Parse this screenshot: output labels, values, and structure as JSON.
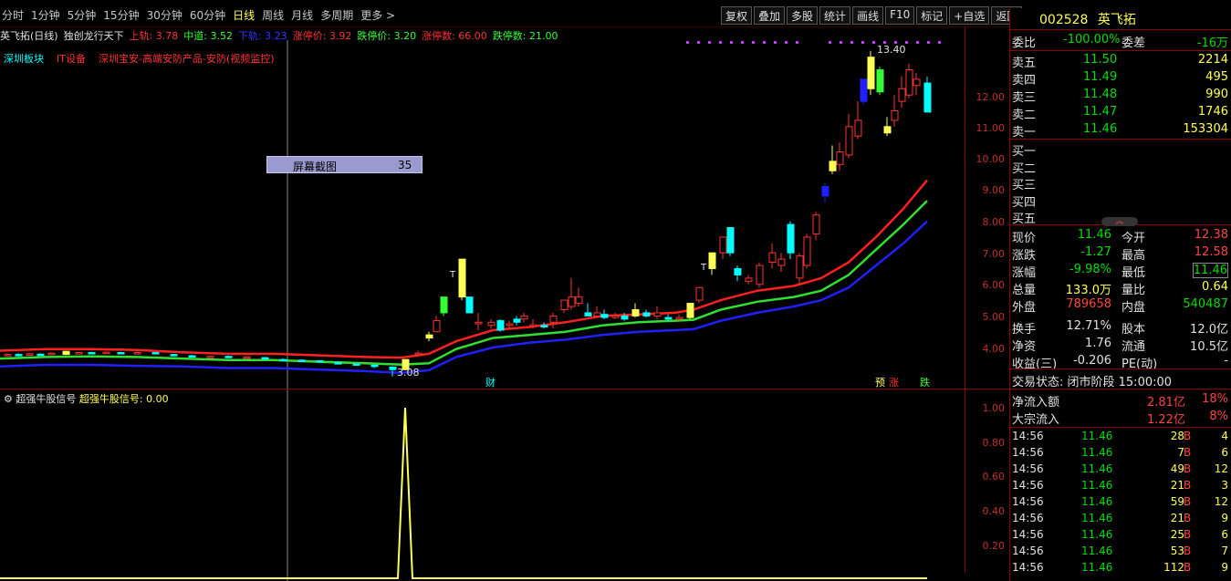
{
  "periods": [
    "分时",
    "1分钟",
    "5分钟",
    "15分钟",
    "30分钟",
    "60分钟",
    "日线",
    "周线",
    "月线",
    "多周期",
    "更多 >"
  ],
  "active_period": "日线",
  "tools": [
    "复权",
    "叠加",
    "多股",
    "统计",
    "画线",
    "F10",
    "标记",
    "+自选",
    "返回"
  ],
  "main_header": {
    "name": "英飞拓(日线)",
    "indicator": "独创龙行天下",
    "upper_label": "上轨: 3.78",
    "middle_label": "中道: 3.52",
    "lower_label": "下轨: 3.23",
    "limit_up_price": "涨停价: 3.92",
    "limit_down_price": "跌停价: 3.20",
    "limit_up_count": "涨停数: 66.00",
    "limit_down_count": "跌停数: 21.00"
  },
  "tags": {
    "board": "深圳板块",
    "industry": "IT设备",
    "concept": "深圳宝安-高端安防产品-安防(视频监控)"
  },
  "price_axis": [
    "12.00",
    "11.00",
    "10.00",
    "9.00",
    "8.00",
    "7.00",
    "6.00",
    "5.00",
    "4.00"
  ],
  "ind_axis": [
    "1.00",
    "0.80",
    "0.60",
    "0.40",
    "0.20"
  ],
  "annotations": {
    "high": "13.40",
    "low": "3.08",
    "cai": "财",
    "yu": "预",
    "zhang": "涨",
    "die": "跌",
    "t": "T"
  },
  "indicator_title": {
    "name": "超强牛股信号",
    "value": "超强牛股信号: 0.00"
  },
  "popup": {
    "label": "屏幕截图",
    "value": "35"
  },
  "quote": {
    "code": "002528",
    "name": "英飞拓",
    "weibi": {
      "label": "委比",
      "value": "-100.00%"
    },
    "weicha": {
      "label": "委差",
      "value": "-16万"
    },
    "asks": [
      {
        "label": "卖五",
        "price": "11.50",
        "vol": "2214"
      },
      {
        "label": "卖四",
        "price": "11.49",
        "vol": "495"
      },
      {
        "label": "卖三",
        "price": "11.48",
        "vol": "990"
      },
      {
        "label": "卖二",
        "price": "11.47",
        "vol": "1746"
      },
      {
        "label": "卖一",
        "price": "11.46",
        "vol": "153304"
      }
    ],
    "bids": [
      "买一",
      "买二",
      "买三",
      "买四",
      "买五"
    ],
    "stats": [
      {
        "l1": "现价",
        "v1": "11.46",
        "l2": "今开",
        "v2": "12.38"
      },
      {
        "l1": "涨跌",
        "v1": "-1.27",
        "l2": "最高",
        "v2": "12.58"
      },
      {
        "l1": "涨幅",
        "v1": "-9.98%",
        "l2": "最低",
        "v2": "11.46"
      },
      {
        "l1": "总量",
        "v1": "133.0万",
        "l2": "量比",
        "v2": "0.64"
      },
      {
        "l1": "外盘",
        "v1": "789658",
        "l2": "内盘",
        "v2": "540487"
      },
      {
        "l1": "换手",
        "v1": "12.71%",
        "l2": "股本",
        "v2": "12.0亿"
      },
      {
        "l1": "净资",
        "v1": "1.76",
        "l2": "流通",
        "v2": "10.5亿"
      },
      {
        "l1": "收益(三)",
        "v1": "-0.206",
        "l2": "PE(动)",
        "v2": "-"
      }
    ],
    "trade_state": "交易状态: 闭市阶段 15:00:00",
    "net_inflow": {
      "label": "净流入额",
      "value": "2.81亿",
      "pct": "18%"
    },
    "block_inflow": {
      "label": "大宗流入",
      "value": "1.22亿",
      "pct": "8%"
    },
    "ticks": [
      {
        "t": "14:56",
        "p": "11.46",
        "v": "28",
        "s": "B",
        "n": "4"
      },
      {
        "t": "14:56",
        "p": "11.46",
        "v": "7",
        "s": "B",
        "n": "6"
      },
      {
        "t": "14:56",
        "p": "11.46",
        "v": "49",
        "s": "B",
        "n": "12"
      },
      {
        "t": "14:56",
        "p": "11.46",
        "v": "21",
        "s": "B",
        "n": "3"
      },
      {
        "t": "14:56",
        "p": "11.46",
        "v": "59",
        "s": "B",
        "n": "12"
      },
      {
        "t": "14:56",
        "p": "11.46",
        "v": "21",
        "s": "B",
        "n": "9"
      },
      {
        "t": "14:56",
        "p": "11.46",
        "v": "25",
        "s": "B",
        "n": "6"
      },
      {
        "t": "14:56",
        "p": "11.46",
        "v": "53",
        "s": "B",
        "n": "7"
      },
      {
        "t": "14:56",
        "p": "11.46",
        "v": "112",
        "s": "B",
        "n": "9"
      }
    ]
  }
}
